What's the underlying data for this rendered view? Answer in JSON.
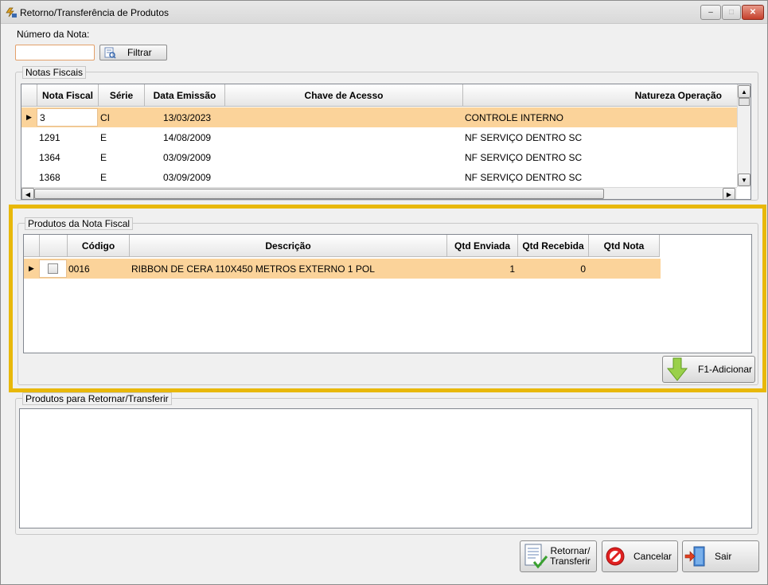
{
  "window": {
    "title": "Retorno/Transferência de Produtos",
    "controls": {
      "minimize": "–",
      "maximize": "□",
      "close": "✕"
    }
  },
  "filter": {
    "label": "Número da Nota:",
    "value": "",
    "button_label": "Filtrar"
  },
  "notas": {
    "group_title": "Notas Fiscais",
    "columns": [
      "Nota Fiscal",
      "Série",
      "Data Emissão",
      "Chave de Acesso",
      "Natureza Operação"
    ],
    "rows": [
      {
        "nota": "3",
        "serie": "CI",
        "data": "13/03/2023",
        "chave": "",
        "natureza": "CONTROLE INTERNO",
        "selected": true
      },
      {
        "nota": "1291",
        "serie": "E",
        "data": "14/08/2009",
        "chave": "",
        "natureza": "NF SERVIÇO DENTRO SC",
        "selected": false
      },
      {
        "nota": "1364",
        "serie": "E",
        "data": "03/09/2009",
        "chave": "",
        "natureza": "NF SERVIÇO DENTRO SC",
        "selected": false
      },
      {
        "nota": "1368",
        "serie": "E",
        "data": "03/09/2009",
        "chave": "",
        "natureza": "NF SERVIÇO DENTRO SC",
        "selected": false
      }
    ]
  },
  "produtos": {
    "group_title": "Produtos da Nota Fiscal",
    "columns": [
      "",
      "Código",
      "Descrição",
      "Qtd Enviada",
      "Qtd Recebida",
      "Qtd Nota"
    ],
    "rows": [
      {
        "checked": false,
        "codigo": "0016",
        "descricao": "RIBBON DE CERA 110X450 METROS EXTERNO 1 POL",
        "qtd_enviada": "1",
        "qtd_recebida": "0",
        "qtd_nota": "",
        "selected": true
      }
    ],
    "add_button": "F1-Adicionar"
  },
  "retornar": {
    "group_title": "Produtos para Retornar/Transferir"
  },
  "actions": {
    "retornar_line1": "Retornar/",
    "retornar_line2": "Transferir",
    "cancelar": "Cancelar",
    "sair": "Sair"
  },
  "colors": {
    "selection": "#fbd39a",
    "highlight_border": "#e8b80a",
    "window_bg": "#f0f0f0"
  }
}
